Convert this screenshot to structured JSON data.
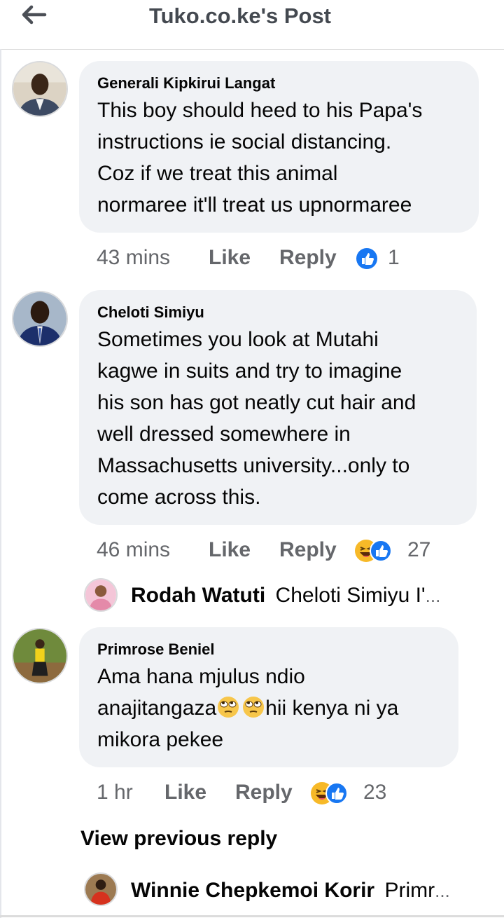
{
  "header": {
    "title": "Tuko.co.ke's Post"
  },
  "comments": [
    {
      "author": "Generali Kipkirui Langat",
      "text": "This boy should heed to his Papa's\ninstructions ie social distancing.\nCoz if we treat this animal\nnormaree it'll treat us upnormaree",
      "time": "43 mins",
      "like": "Like",
      "reply": "Reply",
      "reactions": [
        "like"
      ],
      "reaction_count": "1"
    },
    {
      "author": "Cheloti Simiyu",
      "text": "Sometimes you look at Mutahi\nkagwe in suits and try to imagine\nhis son has got neatly cut hair and\nwell dressed somewhere in\nMassachusetts university...only to\ncome across this.",
      "time": "46 mins",
      "like": "Like",
      "reply": "Reply",
      "reactions": [
        "haha",
        "like"
      ],
      "reaction_count": "27",
      "reply_preview": {
        "name": "Rodah Watuti",
        "text": "Cheloti Simiyu I'",
        "ellipsis": "..."
      }
    },
    {
      "author": "Primrose Beniel",
      "text_line1": "Ama hana mjulus ndio",
      "text_line2_a": "anajitangaza",
      "text_line2_b": "hii kenya ni ya",
      "text_line3": "mikora pekee",
      "emoji": "eye-roll-emoji",
      "time": "1 hr",
      "like": "Like",
      "reply": "Reply",
      "reactions": [
        "haha",
        "like"
      ],
      "reaction_count": "23",
      "view_previous": "View previous reply",
      "reply_preview": {
        "name": "Winnie Chepkemoi Korir",
        "text": "Primr",
        "ellipsis": "..."
      }
    }
  ],
  "colors": {
    "like_blue": "#1877f2",
    "haha_yellow": "#f7b928",
    "muted_text": "#65676b",
    "bubble_bg": "#f0f2f5"
  }
}
